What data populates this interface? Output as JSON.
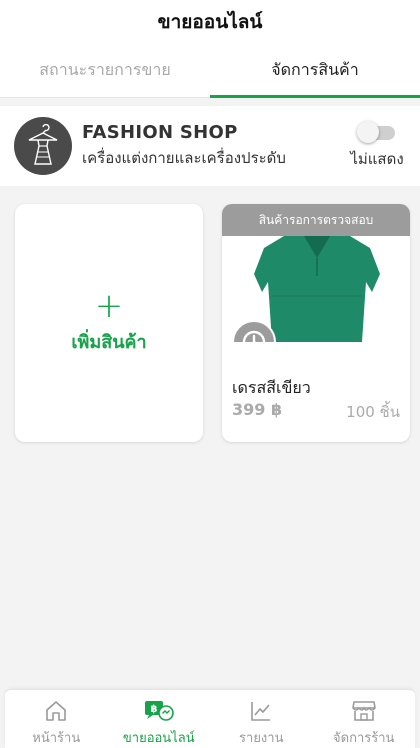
{
  "header": {
    "title": "ขายออนไลน์"
  },
  "tabs": [
    {
      "label": "สถานะรายการขาย",
      "active": false
    },
    {
      "label": "จัดการสินค้า",
      "active": true
    }
  ],
  "shop": {
    "name": "FASHION SHOP",
    "description": "เครื่องแต่งกายและเครื่องประดับ",
    "visibility_label": "ไม่แสดง",
    "visible": false
  },
  "add_card": {
    "plus": "+",
    "label": "เพิ่มสินค้า"
  },
  "product": {
    "status_banner": "สินค้ารอการตรวจสอบ",
    "name": "เดรสสีเขียว",
    "price": "399 ฿",
    "stock": "100 ชิ้น",
    "image_icon": "green-dress",
    "badge_icon": "clock-icon"
  },
  "bottom_nav": [
    {
      "label": "หน้าร้าน",
      "icon": "home-icon",
      "active": false
    },
    {
      "label": "ขายออนไลน์",
      "icon": "online-sale-icon",
      "active": true
    },
    {
      "label": "รายงาน",
      "icon": "chart-icon",
      "active": false
    },
    {
      "label": "จัดการร้าน",
      "icon": "store-icon",
      "active": false
    }
  ],
  "colors": {
    "accent": "#17a34a",
    "muted": "#9c9c9c",
    "background": "#f3f3f3"
  }
}
